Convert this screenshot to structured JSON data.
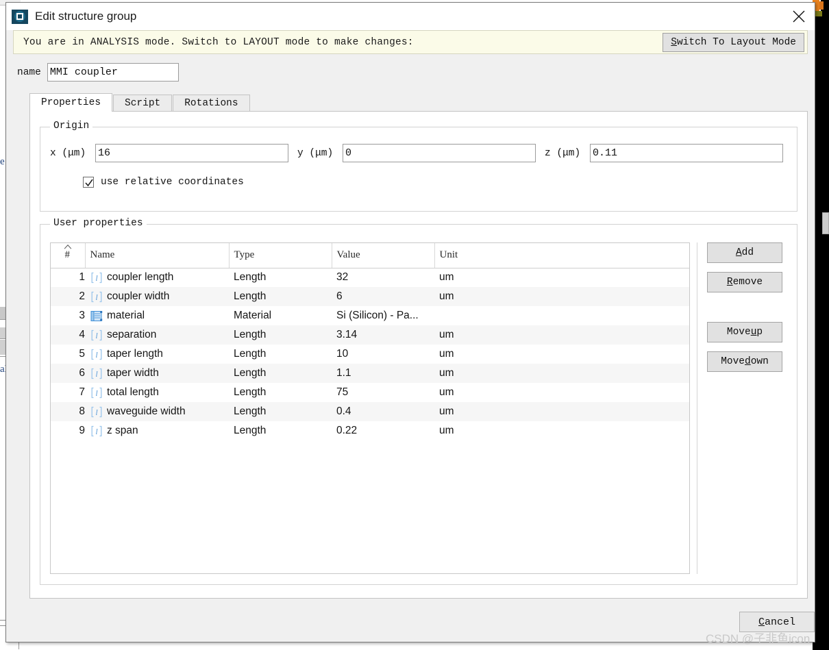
{
  "window": {
    "title": "Edit structure group",
    "app_icon": "lumerical-app-icon",
    "close_icon": "close-icon"
  },
  "banner": {
    "message": "You are in ANALYSIS mode.  Switch to LAYOUT mode to make changes:",
    "button_accel": "S",
    "button_rest": "witch To Layout Mode"
  },
  "name_field": {
    "label": "name",
    "value": "MMI coupler"
  },
  "tabs": [
    {
      "label": "Properties",
      "active": true
    },
    {
      "label": "Script",
      "active": false
    },
    {
      "label": "Rotations",
      "active": false
    }
  ],
  "origin": {
    "title": "Origin",
    "x_label": "x (μm)",
    "x_value": "16",
    "y_label": "y (μm)",
    "y_value": "0",
    "z_label": "z (μm)",
    "z_value": "0.11",
    "relative_label": "use relative coordinates",
    "relative_checked": true
  },
  "user_properties": {
    "title": "User properties",
    "columns": [
      "#",
      "Name",
      "Type",
      "Value",
      "Unit"
    ],
    "sort_column": "#",
    "sort_direction": "ascending",
    "rows": [
      {
        "num": "1",
        "icon": "length-variable-icon",
        "name": "coupler length",
        "type": "Length",
        "value": "32",
        "unit": "um"
      },
      {
        "num": "2",
        "icon": "length-variable-icon",
        "name": "coupler width",
        "type": "Length",
        "value": "6",
        "unit": "um"
      },
      {
        "num": "3",
        "icon": "material-list-icon",
        "name": "material",
        "type": "Material",
        "value": "Si (Silicon) - Pa...",
        "unit": ""
      },
      {
        "num": "4",
        "icon": "length-variable-icon",
        "name": "separation",
        "type": "Length",
        "value": "3.14",
        "unit": "um"
      },
      {
        "num": "5",
        "icon": "length-variable-icon",
        "name": "taper length",
        "type": "Length",
        "value": "10",
        "unit": "um"
      },
      {
        "num": "6",
        "icon": "length-variable-icon",
        "name": "taper width",
        "type": "Length",
        "value": "1.1",
        "unit": "um"
      },
      {
        "num": "7",
        "icon": "length-variable-icon",
        "name": "total length",
        "type": "Length",
        "value": "75",
        "unit": "um"
      },
      {
        "num": "8",
        "icon": "length-variable-icon",
        "name": "waveguide width",
        "type": "Length",
        "value": "0.4",
        "unit": "um"
      },
      {
        "num": "9",
        "icon": "length-variable-icon",
        "name": "z span",
        "type": "Length",
        "value": "0.22",
        "unit": "um"
      }
    ]
  },
  "side_buttons": [
    {
      "id": "add",
      "accel": "A",
      "rest": "dd"
    },
    {
      "id": "remove",
      "accel": "R",
      "rest": "emove"
    },
    {
      "id": "moveup",
      "pre": "Move ",
      "accel": "u",
      "rest": "p"
    },
    {
      "id": "movedown",
      "pre": "Move ",
      "accel": "d",
      "rest": "own"
    }
  ],
  "footer": {
    "cancel_accel": "C",
    "cancel_rest": "ancel"
  },
  "watermark": "CSDN @子非鱼icon",
  "background_fragments": {
    "left_text_1": "e",
    "left_text_2": "al"
  },
  "colors": {
    "banner_bg": "#fbfbe8",
    "dialog_bg": "#f0f0f0",
    "button_bg": "#e1e1e1",
    "row_alt_bg": "#f6f6f6",
    "icon_blue": "#3f8fd6",
    "title_icon": "#14465e"
  }
}
